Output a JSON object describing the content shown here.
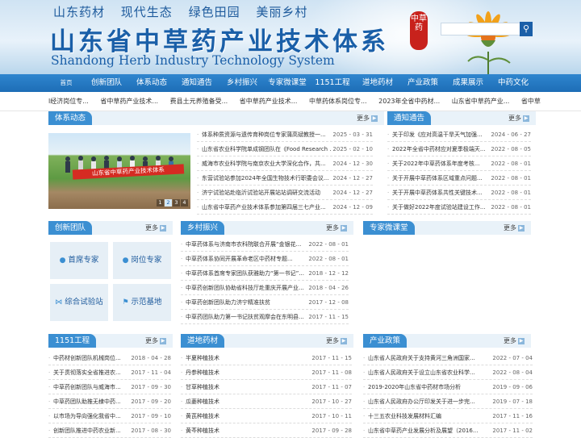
{
  "banner": {
    "slogans": [
      "山东药材",
      "现代生态",
      "绿色田园",
      "美丽乡村"
    ],
    "title": "山东省中草药产业技术体系",
    "subtitle_en": "Shandong Herb Industry Technology System",
    "seal": "中草药",
    "search_icon": "search-icon"
  },
  "nav": [
    "首页",
    "创新团队",
    "体系动态",
    "通知通告",
    "乡村振兴",
    "专家微课堂",
    "1151工程",
    "道地药材",
    "产业政策",
    "成果展示",
    "中药文化"
  ],
  "ticker": [
    "l经济岗位专...",
    "省中草药产业技术...",
    "费县土元养殖备受...",
    "省中草药产业技术...",
    "中草药体系岗位专...",
    "2023年全省中药材...",
    "山东省中草药产业...",
    "省中草"
  ],
  "news": {
    "title": "体系动态",
    "more": "更多",
    "photo_caption": "山东省中草药产业技术体系",
    "pages": [
      "1",
      "2",
      "3",
      "4"
    ],
    "active_page": "2",
    "items": [
      {
        "t": "体系种质资源与遗传育种岗位专家蒲高斌教授一...",
        "d": "2025 - 03 - 31"
      },
      {
        "t": "山东省农业科学院单成钢团队在《Food Research ...",
        "d": "2025 - 02 - 10"
      },
      {
        "t": "威海市农业科学院与南京农业大学深化合作，共...",
        "d": "2024 - 12 - 30"
      },
      {
        "t": "东营试验站参加2024年全国生物技术行职委会议...",
        "d": "2024 - 12 - 27"
      },
      {
        "t": "济宁试验站赴临沂试验站开展站站调研交流活动",
        "d": "2024 - 12 - 27"
      },
      {
        "t": "山东省中草药产业技术体系参加第四届三七产业...",
        "d": "2024 - 12 - 09"
      }
    ]
  },
  "notice": {
    "title": "通知通告",
    "more": "更多",
    "items": [
      {
        "t": "关于印发《应对高温干旱天气加强...",
        "d": "2024 - 06 - 27"
      },
      {
        "t": "2022年全省中药材应对夏季极端天...",
        "d": "2022 - 08 - 05"
      },
      {
        "t": "关于2022年中草药体系年度考核...",
        "d": "2022 - 08 - 01"
      },
      {
        "t": "关于开展中草药体系区域重点问题...",
        "d": "2022 - 08 - 01"
      },
      {
        "t": "关于开展中草药体系共性关键技术...",
        "d": "2022 - 08 - 01"
      },
      {
        "t": "关于做好2022年度试验站建设工作...",
        "d": "2022 - 08 - 01"
      }
    ]
  },
  "team": {
    "title": "创新团队",
    "more": "更多",
    "tiles": [
      {
        "label": "首席专家",
        "icon": "person-icon"
      },
      {
        "label": "岗位专家",
        "icon": "person-icon"
      },
      {
        "label": "综合试验站",
        "icon": "network-icon"
      },
      {
        "label": "示范基地",
        "icon": "flag-icon"
      }
    ]
  },
  "rural": {
    "title": "乡村振兴",
    "more": "更多",
    "items": [
      {
        "t": "中草药体系与济南市农科院联合开展“金银花...",
        "d": "2022 - 08 - 01"
      },
      {
        "t": "中草药体系协同开展革命老区中药材专题...",
        "d": "2022 - 08 - 01"
      },
      {
        "t": "中草药体系首席专家团队获雅助力“第一书记”...",
        "d": "2018 - 12 - 12"
      },
      {
        "t": "中草药创新团队协助省科技厅赴重庆开展产业...",
        "d": "2018 - 04 - 26"
      },
      {
        "t": "中草药创新团队助力济宁精准扶贫",
        "d": "2017 - 12 - 08"
      },
      {
        "t": "中草药团队助力第一书记扶贫观摩会在东明县...",
        "d": "2017 - 11 - 15"
      }
    ]
  },
  "lecture": {
    "title": "专家微课堂",
    "more": "更多"
  },
  "project1151": {
    "title": "1151工程",
    "more": "更多",
    "items": [
      {
        "t": "中药材创新团队机械岗位...",
        "d": "2018 - 04 - 28"
      },
      {
        "t": "关于贯彻落实全省推进农...",
        "d": "2017 - 11 - 04"
      },
      {
        "t": "中草药创新团队与威海市...",
        "d": "2017 - 09 - 30"
      },
      {
        "t": "中草药团队助推无棣中药...",
        "d": "2017 - 09 - 20"
      },
      {
        "t": "以市场为导向强化我省中...",
        "d": "2017 - 09 - 10"
      },
      {
        "t": "创新团队推进中药农业新...",
        "d": "2017 - 08 - 30"
      }
    ]
  },
  "herbs": {
    "title": "道地药材",
    "more": "更多",
    "items": [
      {
        "t": "半夏种植技术",
        "d": "2017 - 11 - 15"
      },
      {
        "t": "丹参种植技术",
        "d": "2017 - 11 - 08"
      },
      {
        "t": "甘草种植技术",
        "d": "2017 - 11 - 07"
      },
      {
        "t": "瓜蒌种植技术",
        "d": "2017 - 10 - 27"
      },
      {
        "t": "黄芪种植技术",
        "d": "2017 - 10 - 11"
      },
      {
        "t": "黄芩种植技术",
        "d": "2017 - 09 - 28"
      }
    ]
  },
  "policy": {
    "title": "产业政策",
    "more": "更多",
    "items": [
      {
        "t": "山东省人民政府关于支持黄河三角洲国家...",
        "d": "2022 - 07 - 04"
      },
      {
        "t": "山东省人民政府关于设立山东省农业科学...",
        "d": "2022 - 08 - 04"
      },
      {
        "t": "2019-2020年山东省中药材市场分析",
        "d": "2019 - 09 - 06"
      },
      {
        "t": "山东省人民政府办公厅印发关于进一步完...",
        "d": "2019 - 07 - 18"
      },
      {
        "t": "十三五农业科技发展材料汇编",
        "d": "2017 - 11 - 16"
      },
      {
        "t": "山东省中草药产业发展分析及展望（2016...",
        "d": "2017 - 11 - 02"
      }
    ]
  },
  "colors": {
    "nav_blue": "#2f86cf",
    "tag_blue": "#3b8fd2",
    "header_bg": "#e9f2f9",
    "title_blue": "#1a5fa8"
  }
}
